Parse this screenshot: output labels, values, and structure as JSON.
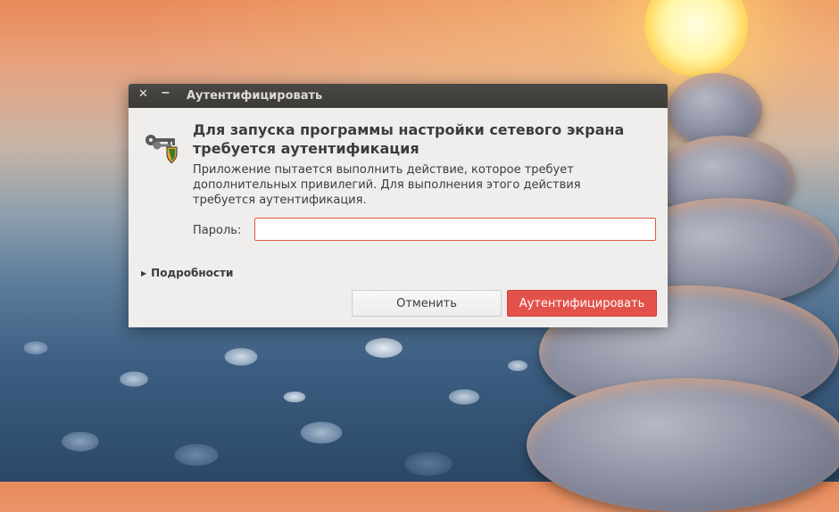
{
  "dialog": {
    "window_title": "Аутентифицировать",
    "heading": "Для запуска программы настройки сетевого экрана требуется аутентификация",
    "message": "Приложение пытается выполнить действие, которое требует дополнительных привилегий. Для выполнения этого действия требуется аутентификация.",
    "password_label": "Пароль:",
    "password_value": "",
    "details_label": "Подробности",
    "cancel_label": "Отменить",
    "authenticate_label": "Аутентифицировать",
    "icons": {
      "close": "close-icon",
      "minimize": "minimize-icon",
      "auth": "keys-shield-icon",
      "details": "triangle-right-icon"
    }
  },
  "colors": {
    "titlebar": "#3c3b37",
    "dialog_bg": "#efeeed",
    "accent": "#e3524a",
    "input_border": "#e05743"
  }
}
